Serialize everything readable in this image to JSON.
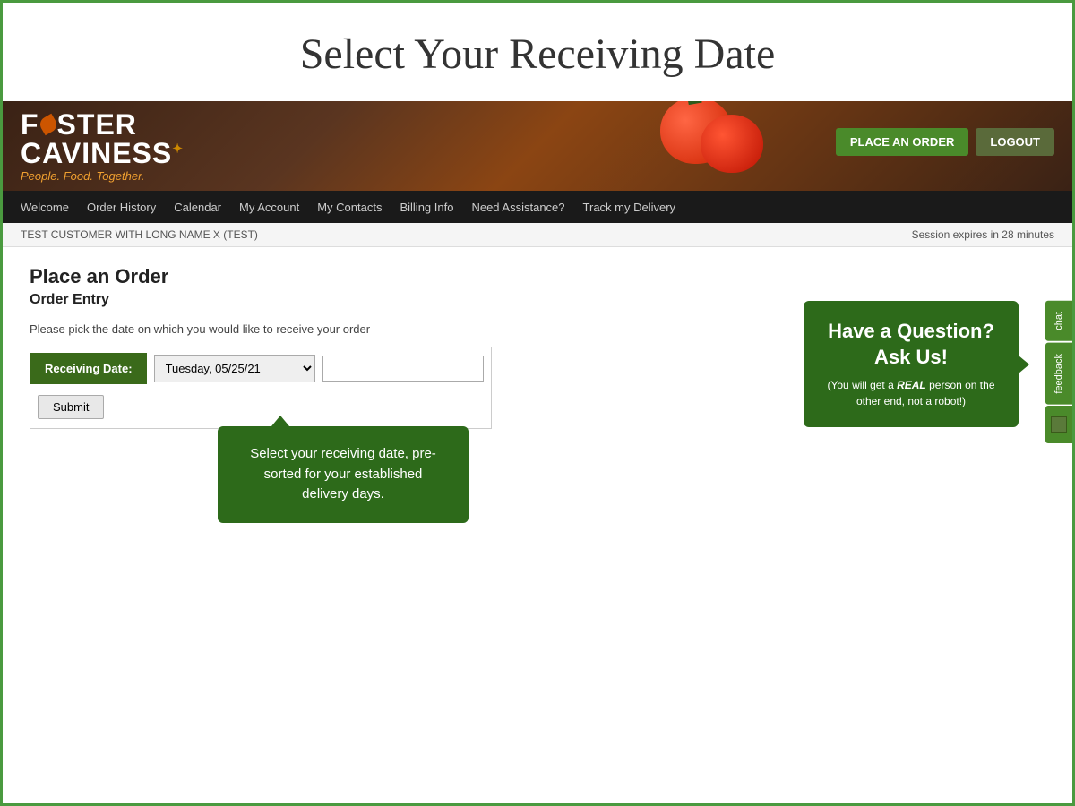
{
  "page": {
    "outer_title": "Select Your Receiving Date",
    "border_color": "#4a9a3f"
  },
  "header": {
    "logo_line1": "FOSTER",
    "logo_line2": "CAVINESS",
    "logo_tagline": "People. Food. Together.",
    "btn_place_order": "PLACE AN ORDER",
    "btn_logout": "LOGOUT"
  },
  "nav": {
    "items": [
      {
        "label": "Welcome",
        "href": "#"
      },
      {
        "label": "Order History",
        "href": "#"
      },
      {
        "label": "Calendar",
        "href": "#"
      },
      {
        "label": "My Account",
        "href": "#"
      },
      {
        "label": "My Contacts",
        "href": "#"
      },
      {
        "label": "Billing Info",
        "href": "#"
      },
      {
        "label": "Need Assistance?",
        "href": "#"
      },
      {
        "label": "Track my Delivery",
        "href": "#"
      }
    ]
  },
  "session_bar": {
    "customer_name": "TEST CUSTOMER WITH LONG NAME X (TEST)",
    "session_info": "Session expires in 28 minutes"
  },
  "main": {
    "title": "Place an Order",
    "subtitle": "Order Entry",
    "instruction": "Please pick the date on which you would like to receive your order",
    "receiving_date_label": "Receiving Date:",
    "date_value": "Tuesday, 05/25/21",
    "submit_label": "Submit"
  },
  "tooltip": {
    "text": "Select your receiving date, pre-sorted for your established delivery days."
  },
  "question_box": {
    "title": "Have a Question? Ask Us!",
    "subtitle": "(You will get a REAL person on the other end, not a robot!)"
  },
  "sidebar": {
    "chat_label": "chat",
    "feedback_label": "feedback"
  }
}
